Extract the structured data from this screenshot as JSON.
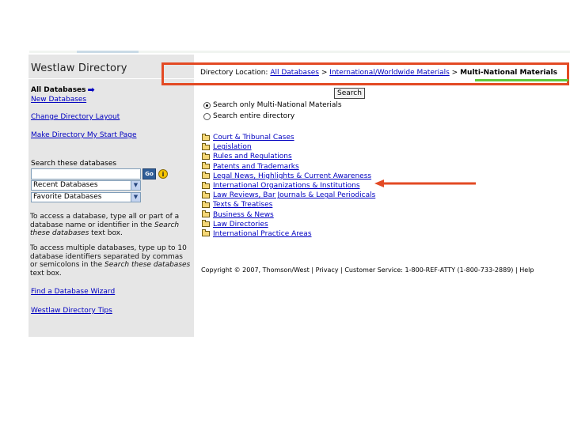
{
  "sidebar": {
    "title": "Westlaw Directory",
    "all_databases": "All Databases",
    "new_databases": "New Databases",
    "change_layout": "Change Directory Layout",
    "make_start_page": "Make Directory My Start Page",
    "search_label": "Search these databases",
    "search_value": "",
    "go_label": "Go",
    "info_label": "i",
    "recent_select": "Recent Databases",
    "favorite_select": "Favorite Databases",
    "help1_pre": "To access a database, type all or part of a database name or identifier in the ",
    "help1_em": "Search these databases",
    "help1_post": " text box.",
    "help2_pre": "To access multiple databases, type up to 10 database identifiers separated by commas or semicolons in the ",
    "help2_em": "Search these databases",
    "help2_post": " text box.",
    "find_wizard": "Find a Database Wizard",
    "tips": "Westlaw Directory Tips"
  },
  "location": {
    "label": "Directory Location:",
    "crumb1": "All Databases",
    "sep": ">",
    "crumb2": "International/Worldwide Materials",
    "current": "Multi-National Materials"
  },
  "search": {
    "button": "Search",
    "option_only": "Search only Multi-National Materials",
    "option_entire": "Search entire directory"
  },
  "folders": [
    "Court & Tribunal Cases",
    "Legislation",
    "Rules and Regulations",
    "Patents and Trademarks",
    "Legal News, Highlights & Current Awareness",
    "International Organizations & Institutions",
    "Law Reviews, Bar Journals & Legal Periodicals",
    "Texts & Treatises",
    "Business & News",
    "Law Directories",
    "International Practice Areas"
  ],
  "footer": {
    "copyright": "Copyright © 2007, Thomson/West",
    "sep": "|",
    "privacy": "Privacy",
    "customer_service": "Customer Service: 1-800-REF-ATTY (1-800-733-2889)",
    "help": "Help"
  },
  "colors": {
    "callout_box": "#e34a24",
    "current_underline": "#5ec83a",
    "link": "#0000c0",
    "sidebar_bg": "#e6e6e6"
  }
}
